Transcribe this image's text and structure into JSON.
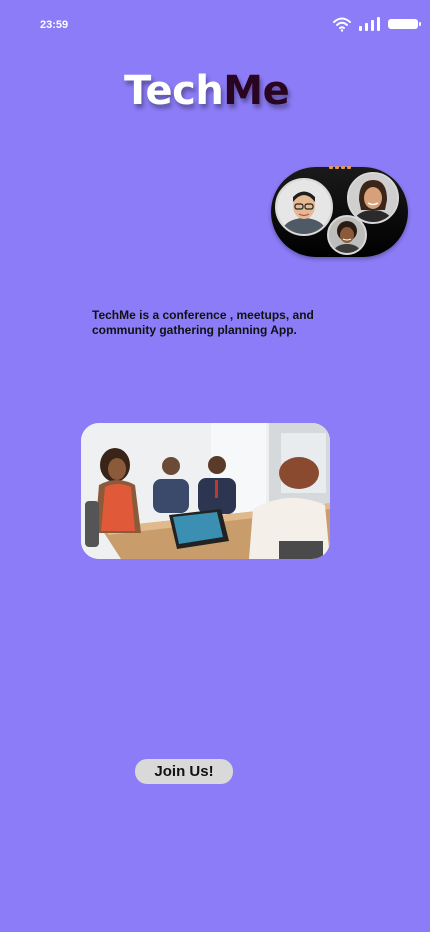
{
  "status_bar": {
    "time": "23:59"
  },
  "logo": {
    "part1": "Tech",
    "part2": "Me"
  },
  "description": "TechMe is a conference , meetups, and community gathering planning App.",
  "join_button": {
    "label": "Join Us!"
  },
  "colors": {
    "background": "#8c7cf7",
    "logo_accent": "#2a0522",
    "button": "#d9d9d9"
  }
}
